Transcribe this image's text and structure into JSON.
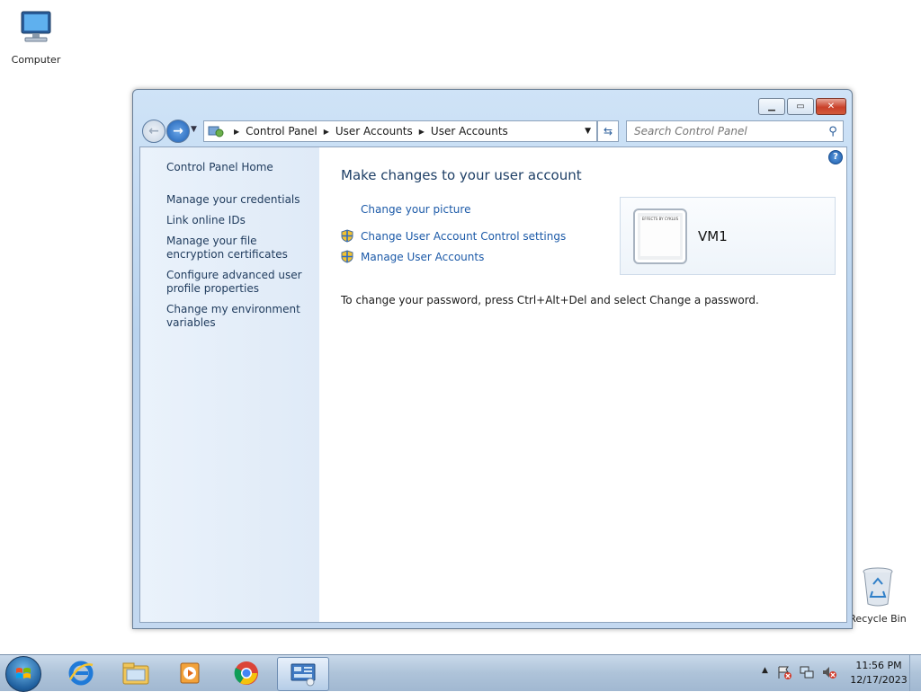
{
  "desktop": {
    "computer_label": "Computer",
    "recycle_label": "Recycle Bin"
  },
  "window": {
    "address": {
      "crumbs": [
        "Control Panel",
        "User Accounts",
        "User Accounts"
      ]
    },
    "search": {
      "placeholder": "Search Control Panel"
    },
    "sidebar": {
      "home": "Control Panel Home",
      "links": [
        "Manage your credentials",
        "Link online IDs",
        "Manage your file encryption certificates",
        "Configure advanced user profile properties",
        "Change my environment variables"
      ]
    },
    "main": {
      "heading": "Make changes to your user account",
      "tasks": [
        {
          "label": "Change your picture",
          "icon": "none"
        },
        {
          "label": "Change User Account Control settings",
          "icon": "uac-shield-icon"
        },
        {
          "label": "Manage User Accounts",
          "icon": "uac-shield-icon"
        }
      ],
      "info": "To change your password, press Ctrl+Alt+Del and select Change a password.",
      "account": {
        "name": "VM1",
        "picture_text": "EFFECTS BY CYKLUS"
      }
    }
  },
  "taskbar": {
    "apps": [
      "internet-explorer-icon",
      "file-explorer-icon",
      "media-player-icon",
      "chrome-icon",
      "control-panel-icon"
    ],
    "clock": {
      "time": "11:56 PM",
      "date": "12/17/2023"
    }
  },
  "colors": {
    "link": "#1c5aa8",
    "heading": "#1e3f66",
    "sidebar_text": "#1e3a5c",
    "taskbar": "#aec3d9"
  }
}
